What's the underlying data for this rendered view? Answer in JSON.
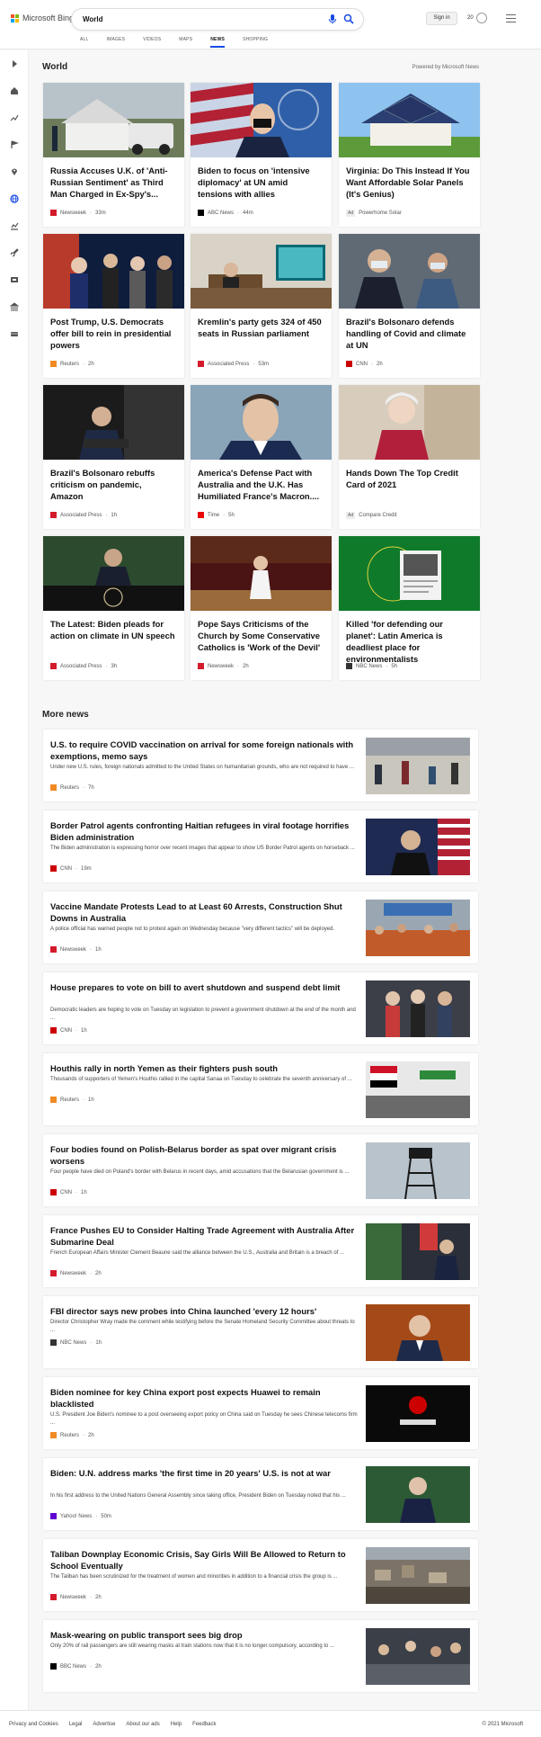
{
  "header": {
    "logo_text": "Microsoft Bing",
    "search_value": "World",
    "signin_label": "Sign in",
    "rewards_count": "20",
    "tabs": [
      "ALL",
      "IMAGES",
      "VIDEOS",
      "MAPS",
      "NEWS",
      "SHOPPING"
    ],
    "active_tab": "NEWS"
  },
  "section": {
    "title": "World",
    "powered_by": "Powered by Microsoft News"
  },
  "cards": [
    {
      "title": "Russia Accuses U.K. of 'Anti-Russian Sentiment' as Third Man Charged in Ex-Spy's...",
      "source": "Newsweek",
      "time": "33m",
      "badge": "N",
      "badge_color": "#d41b2c",
      "img": "house"
    },
    {
      "title": "Biden to focus on 'intensive diplomacy' at UN amid tensions with allies",
      "source": "ABC News",
      "time": "44m",
      "badge": "a",
      "badge_color": "#000000",
      "img": "biden"
    },
    {
      "title": "Virginia: Do This Instead If You Want Affordable Solar Panels (It's Genius)",
      "source": "Powerhome Solar",
      "time": "",
      "badge": "Ad",
      "badge_color": "",
      "img": "solar"
    },
    {
      "title": "Post Trump, U.S. Democrats offer bill to rein in presidential powers",
      "source": "Reuters",
      "time": "2h",
      "badge": "R",
      "badge_color": "#f08a24",
      "img": "pelosi"
    },
    {
      "title": "Kremlin's party gets 324 of 450 seats in Russian parliament",
      "source": "Associated Press",
      "time": "53m",
      "badge": "AP",
      "badge_color": "#d41b2c",
      "img": "kremlin"
    },
    {
      "title": "Brazil's Bolsonaro defends handling of Covid and climate at UN",
      "source": "CNN",
      "time": "2h",
      "badge": "CNN",
      "badge_color": "#cc0000",
      "img": "bolsonaro"
    },
    {
      "title": "Brazil's Bolsonaro rebuffs criticism on pandemic, Amazon",
      "source": "Associated Press",
      "time": "1h",
      "badge": "AP",
      "badge_color": "#d41b2c",
      "img": "bolsonaro2"
    },
    {
      "title": "America's Defense Pact with Australia and the U.K. Has Humiliated France's Macron....",
      "source": "Time",
      "time": "5h",
      "badge": "T",
      "badge_color": "#e90606",
      "img": "macron"
    },
    {
      "title": "Hands Down The Top Credit Card of 2021",
      "source": "Compare Credit",
      "time": "",
      "badge": "Ad",
      "badge_color": "",
      "img": "woman"
    },
    {
      "title": "The Latest: Biden pleads for action on climate in UN speech",
      "source": "Associated Press",
      "time": "3h",
      "badge": "AP",
      "badge_color": "#d41b2c",
      "img": "un"
    },
    {
      "title": "Pope Says Criticisms of the Church by Some Conservative Catholics is 'Work of the Devil'",
      "source": "Newsweek",
      "time": "2h",
      "badge": "N",
      "badge_color": "#d41b2c",
      "img": "pope"
    },
    {
      "title": "Killed 'for defending our planet': Latin America is deadliest place for environmentalists",
      "source": "NBC News",
      "time": "5h",
      "badge": "nbc",
      "badge_color": "#333333",
      "img": "green"
    }
  ],
  "more": {
    "title": "More news",
    "items": [
      {
        "title": "U.S. to require COVID vaccination on arrival for some foreign nationals with exemptions, memo says",
        "desc": "Under new U.S. rules, foreign nationals admitted to the United States on humanitarian grounds, who are not required to have ...",
        "source": "Reuters",
        "time": "7h",
        "badge": "R",
        "badge_color": "#f08a24",
        "img": "airport"
      },
      {
        "title": "Border Patrol agents confronting Haitian refugees in viral footage horrifies Biden administration",
        "desc": "The Biden administration is expressing horror over recent images that appear to show US Border Patrol agents on horseback ...",
        "source": "CNN",
        "time": "19m",
        "badge": "CNN",
        "badge_color": "#cc0000",
        "img": "mayorkas"
      },
      {
        "title": "Vaccine Mandate Protests Lead to at Least 60 Arrests, Construction Shut Downs in Australia",
        "desc": "A police official has warned people not to protest again on Wednesday because \"very different tactics\" will be deployed.",
        "source": "Newsweek",
        "time": "1h",
        "badge": "N",
        "badge_color": "#d41b2c",
        "img": "protest"
      },
      {
        "title": "House prepares to vote on bill to avert shutdown and suspend debt limit",
        "desc": "Democratic leaders are hoping to vote on Tuesday on legislation to prevent a government shutdown at the end of the month and ...",
        "source": "CNN",
        "time": "1h",
        "badge": "CNN",
        "badge_color": "#cc0000",
        "img": "house_dems"
      },
      {
        "title": "Houthis rally in north Yemen as their fighters push south",
        "desc": "Thousands of supporters of Yemen's Houthis rallied in the capital Sanaa on Tuesday to celebrate the seventh anniversary of ...",
        "source": "Reuters",
        "time": "1h",
        "badge": "R",
        "badge_color": "#f08a24",
        "img": "yemen"
      },
      {
        "title": "Four bodies found on Polish-Belarus border as spat over migrant crisis worsens",
        "desc": "Four people have died on Poland's border with Belarus in recent days, amid accusations that the Belarusian government is ...",
        "source": "CNN",
        "time": "1h",
        "badge": "CNN",
        "badge_color": "#cc0000",
        "img": "tower"
      },
      {
        "title": "France Pushes EU to Consider Halting Trade Agreement with Australia After Submarine Deal",
        "desc": "French European Affairs Minister Clement Beaune said the alliance between the U.S., Australia and Britain is a breach of ...",
        "source": "Newsweek",
        "time": "2h",
        "badge": "N",
        "badge_color": "#d41b2c",
        "img": "beaune"
      },
      {
        "title": "FBI director says new probes into China launched 'every 12 hours'",
        "desc": "Director Christopher Wray made the comment while testifying before the Senate Homeland Security Committee about threats to ...",
        "source": "NBC News",
        "time": "1h",
        "badge": "nbc",
        "badge_color": "#333333",
        "img": "wray"
      },
      {
        "title": "Biden nominee for key China export post expects Huawei to remain blacklisted",
        "desc": "U.S. President Joe Biden's nominee to a post overseeing export policy on China said on Tuesday he sees Chinese telecoms firm ...",
        "source": "Reuters",
        "time": "2h",
        "badge": "R",
        "badge_color": "#f08a24",
        "img": "huawei"
      },
      {
        "title": "Biden: U.N. address marks 'the first time in 20 years' U.S. is not at war",
        "desc": "In his first address to the United Nations General Assembly since taking office, President Biden on Tuesday noted that his ...",
        "source": "Yahoo! News",
        "time": "50m",
        "badge": "Y",
        "badge_color": "#6001d2",
        "img": "biden_un"
      },
      {
        "title": "Taliban Downplay Economic Crisis, Say Girls Will Be Allowed to Return to School Eventually",
        "desc": "The Taliban has been scrutinized for the treatment of women and minorities in addition to a financial crisis the group is ...",
        "source": "Newsweek",
        "time": "2h",
        "badge": "N",
        "badge_color": "#d41b2c",
        "img": "kabul"
      },
      {
        "title": "Mask-wearing on public transport sees big drop",
        "desc": "Only 20% of rail passengers are still wearing masks at train stations now that it is no longer compulsory, according to ...",
        "source": "BBC News",
        "time": "2h",
        "badge": "BBC",
        "badge_color": "#000000",
        "img": "station"
      }
    ]
  },
  "footer": {
    "links": [
      "Privacy and Cookies",
      "Legal",
      "Advertise",
      "About our ads",
      "Help",
      "Feedback"
    ],
    "copyright": "© 2021 Microsoft"
  },
  "colors": {
    "accent": "#174ae4",
    "logo_red": "#f25022",
    "logo_green": "#7fba00",
    "logo_blue": "#00a4ef",
    "logo_yellow": "#ffb900"
  }
}
